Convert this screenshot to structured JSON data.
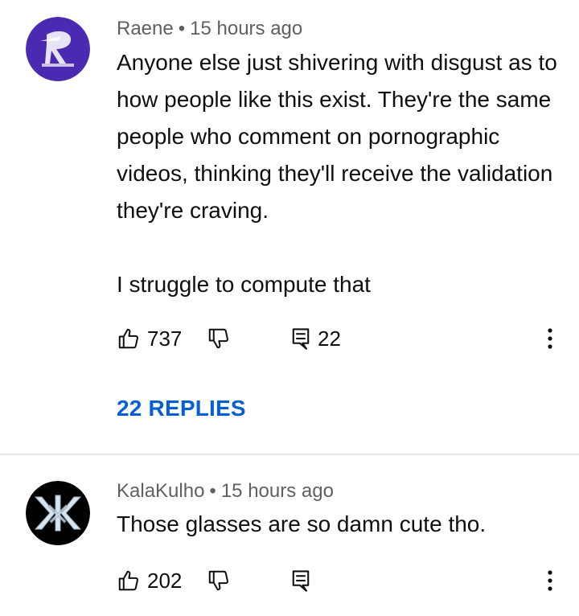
{
  "comments": [
    {
      "author": "Raene",
      "time": "15 hours ago",
      "paragraphs": [
        "Anyone else just shivering with disgust as to how people like this exist. They're the same people who comment on pornographic videos, thinking they'll receive the validation they're craving.",
        "I struggle to compute that"
      ],
      "likes": "737",
      "reply_count": "22",
      "replies_link": "22 REPLIES"
    },
    {
      "author": "KalaKulho",
      "time": "15 hours ago",
      "paragraphs": [
        "Those glasses are so damn cute tho."
      ],
      "likes": "202"
    }
  ],
  "separator": "•",
  "colors": {
    "link": "#065fd4",
    "meta": "#606060",
    "avatar1": "#4a2ab0",
    "avatar2": "#000000"
  },
  "icons": [
    "thumbs-up-icon",
    "thumbs-down-icon",
    "reply-icon",
    "more-vert-icon"
  ]
}
